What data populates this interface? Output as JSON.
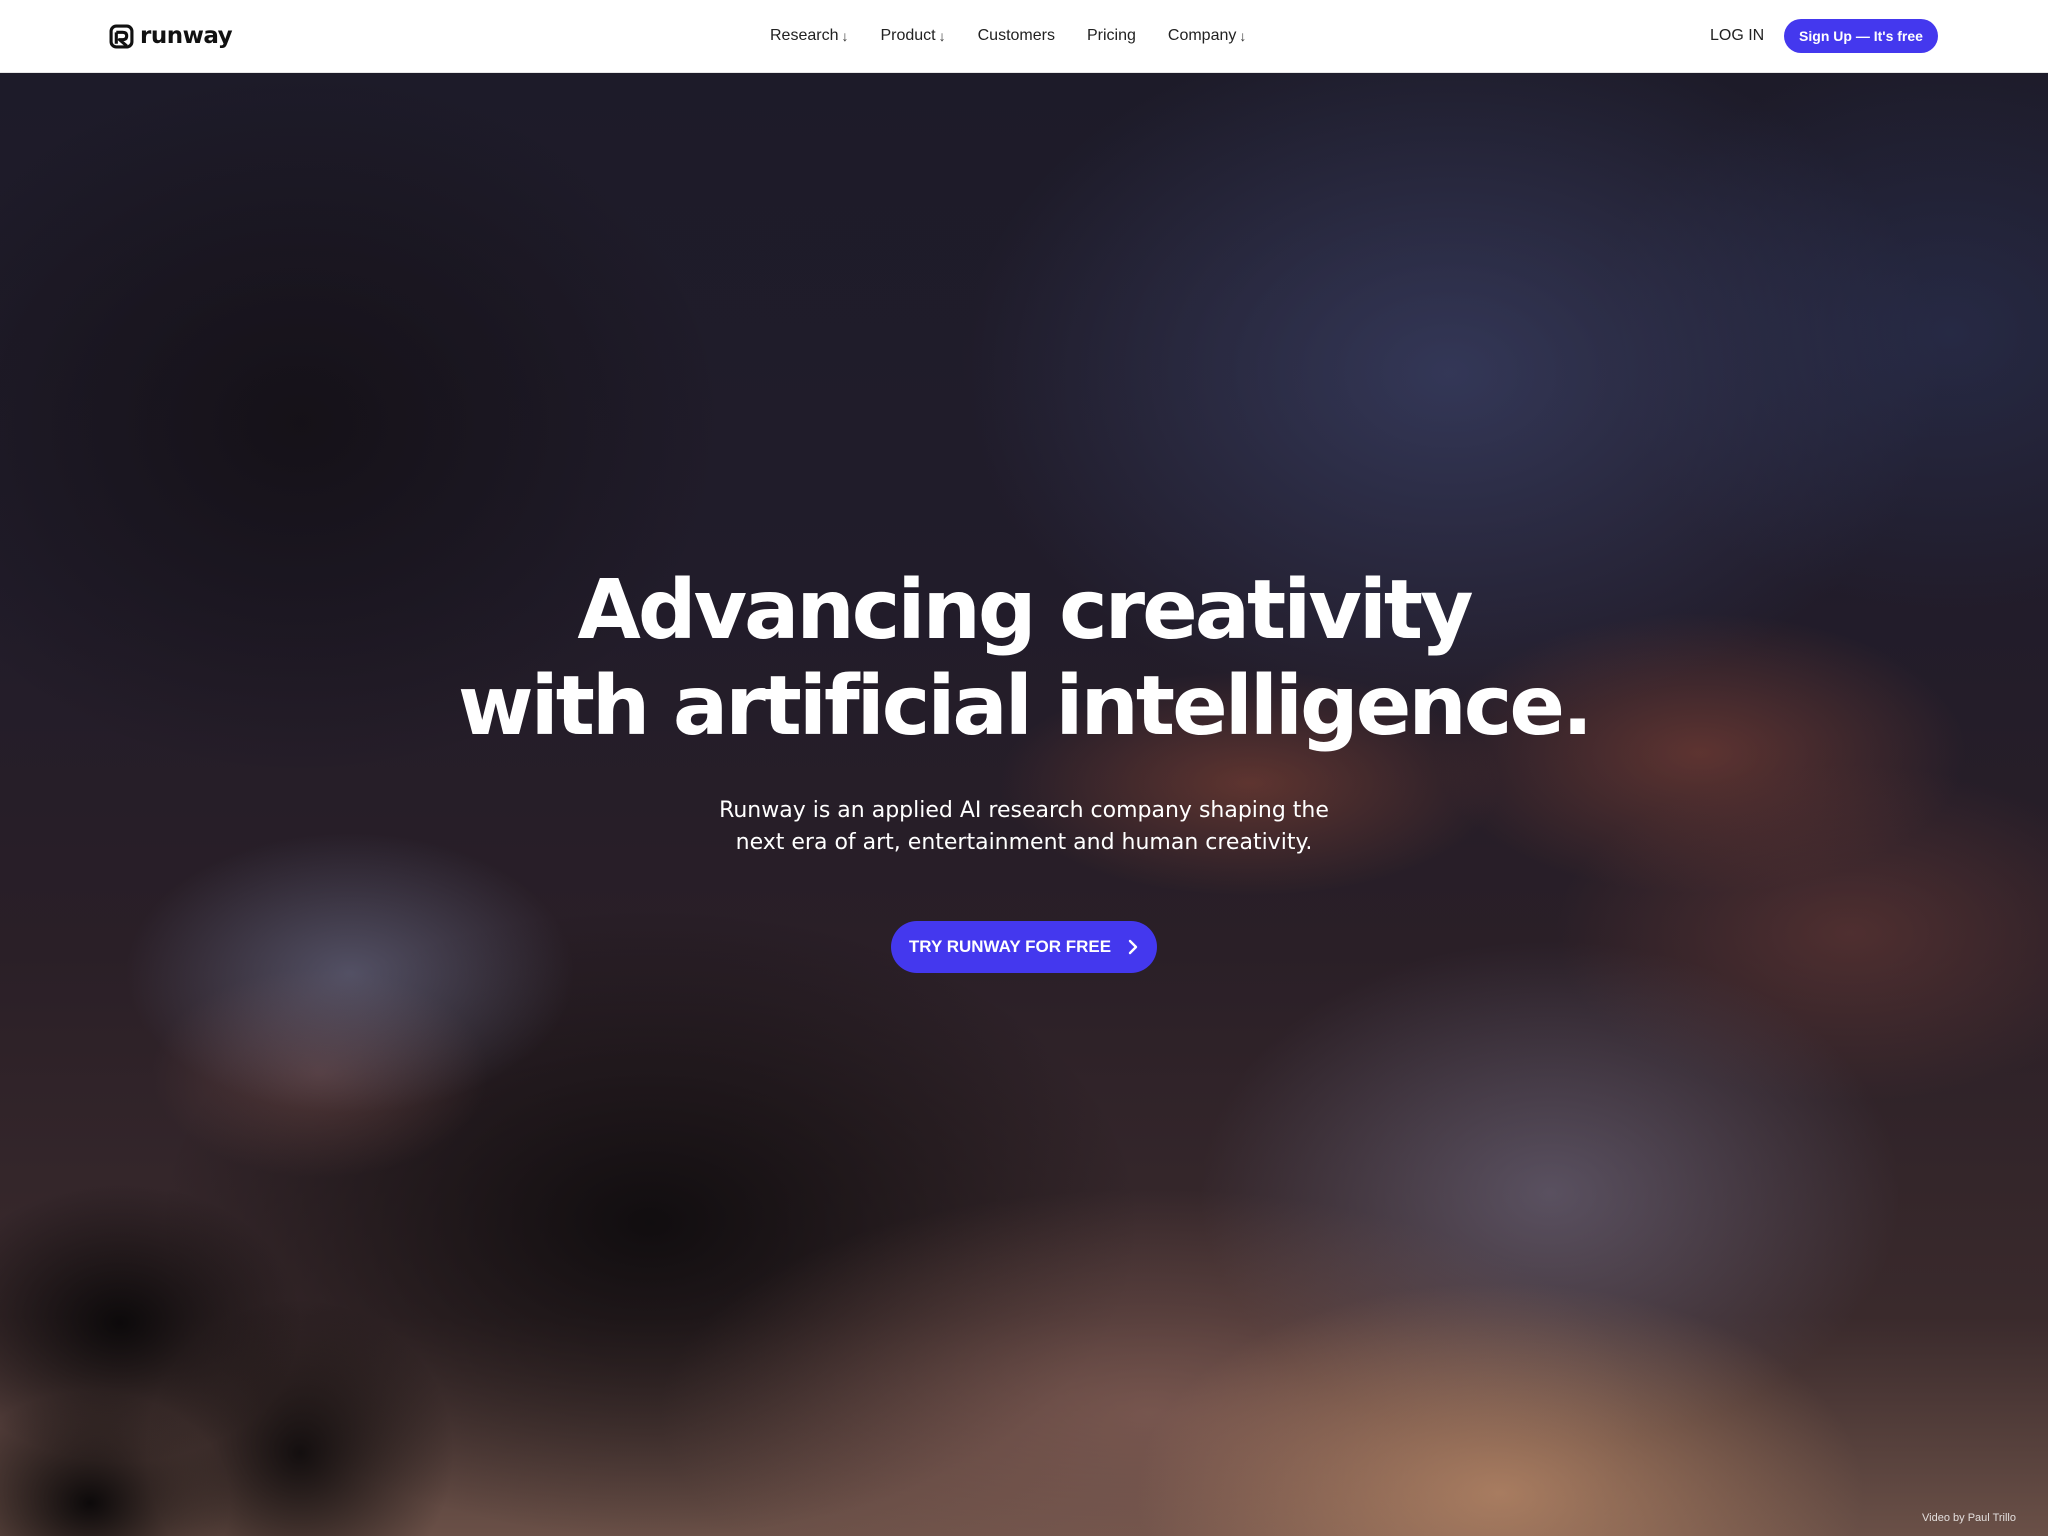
{
  "brand": {
    "name": "runway",
    "accent_color": "#4438ee"
  },
  "nav": {
    "items": [
      {
        "label": "Research",
        "arrow": "↓"
      },
      {
        "label": "Product",
        "arrow": "↓"
      },
      {
        "label": "Customers"
      },
      {
        "label": "Pricing"
      },
      {
        "label": "Company",
        "arrow": "↓"
      }
    ],
    "login_label": "LOG IN",
    "signup_label": "Sign Up — It's free"
  },
  "hero": {
    "title_line1": "Advancing creativity",
    "title_line2": "with artificial intelligence.",
    "subtitle_line1": "Runway is an applied AI research company shaping the",
    "subtitle_line2": "next era of art, entertainment and human creativity.",
    "cta_label": "TRY RUNWAY FOR FREE",
    "cta_icon": "chevron-right-icon"
  },
  "video_credit": "Video by Paul Trillo"
}
